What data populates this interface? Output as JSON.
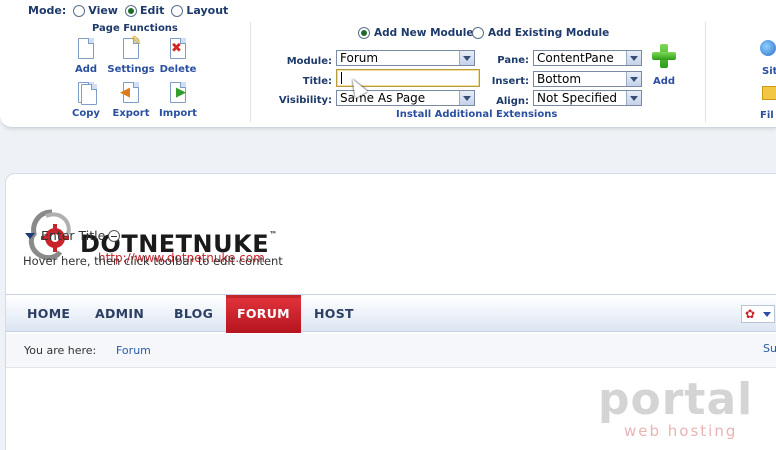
{
  "control_panel": {
    "mode": {
      "label": "Mode:",
      "options": [
        "View",
        "Edit",
        "Layout"
      ],
      "selected": "Edit"
    },
    "page_functions": {
      "title": "Page Functions",
      "tools": [
        "Add",
        "Settings",
        "Delete",
        "Copy",
        "Export",
        "Import"
      ]
    },
    "module": {
      "add_new_label": "Add New Module",
      "add_existing_label": "Add Existing Module",
      "selected_option": "Add New Module",
      "module_label": "Module:",
      "module_value": "Forum",
      "title_label": "Title:",
      "title_value": "",
      "visibility_label": "Visibility:",
      "visibility_value": "Same As Page",
      "pane_label": "Pane:",
      "pane_value": "ContentPane",
      "insert_label": "Insert:",
      "insert_value": "Bottom",
      "align_label": "Align:",
      "align_value": "Not Specified",
      "add_label": "Add",
      "install_link": "Install Additional Extensions"
    },
    "right_edge": {
      "item1": "Sit",
      "item2": "Fil"
    }
  },
  "portal": {
    "logo_text": "DOTNETNUKE",
    "logo_tm": "™",
    "logo_url": "http://www.dotnetnuke.com",
    "nav": {
      "items": [
        "HOME",
        "ADMIN",
        "BLOG",
        "FORUM",
        "HOST"
      ],
      "active": "FORUM"
    },
    "breadcrumb": {
      "label": "You are here:",
      "link": "Forum",
      "right": "Su"
    },
    "module": {
      "title": "Enter Title",
      "hint": "Hover here, then click toolbar to edit content"
    }
  },
  "watermark": {
    "line1": "portal",
    "line2": "web hosting"
  },
  "colors": {
    "nav_active": "#c4262e",
    "link": "#2a4fa0",
    "logo_url": "#c9242c"
  }
}
